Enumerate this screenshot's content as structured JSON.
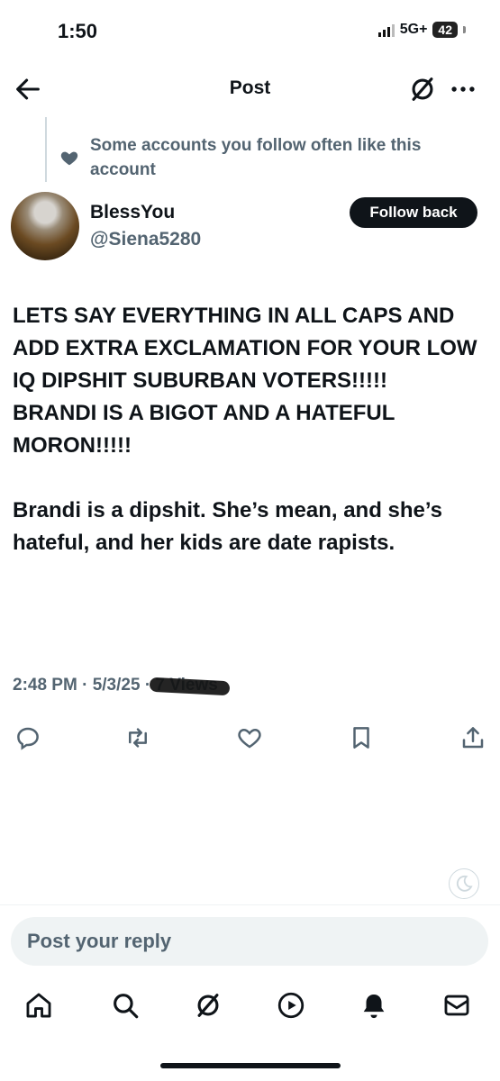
{
  "status_bar": {
    "time": "1:50",
    "network": "5G+",
    "battery": "42"
  },
  "header": {
    "title": "Post",
    "back_icon": "arrow-left-icon",
    "grok_icon": "grok-icon",
    "more_icon": "more-icon"
  },
  "social_context": {
    "text": "Some accounts you follow often like this account",
    "icon": "heart-icon"
  },
  "author": {
    "name": "BlessYou",
    "handle": "@Siena5280",
    "follow_label": "Follow back"
  },
  "post": {
    "paragraphs": [
      "LETS SAY EVERYTHING IN ALL CAPS AND ADD EXTRA EXCLAMATION FOR YOUR LOW IQ DIPSHIT SUBURBAN VOTERS!!!!!\nBRANDI IS A BIGOT AND A HATEFUL MORON!!!!!",
      "Brandi is a dipshit. She’s mean, and she’s hateful, and her kids are date rapists."
    ],
    "time": "2:48 PM",
    "date": "5/3/25",
    "views": "7 Views"
  },
  "actions": [
    "reply-icon",
    "repost-icon",
    "like-icon",
    "bookmark-icon",
    "share-icon"
  ],
  "reply": {
    "placeholder": "Post your reply"
  },
  "bottom_nav": [
    "home-icon",
    "search-icon",
    "grok-icon",
    "video-icon",
    "notifications-icon",
    "messages-icon"
  ],
  "colors": {
    "text": "#0f1419",
    "secondary": "#536471",
    "button_bg": "#0f1419",
    "reply_bg": "#eff3f4"
  }
}
